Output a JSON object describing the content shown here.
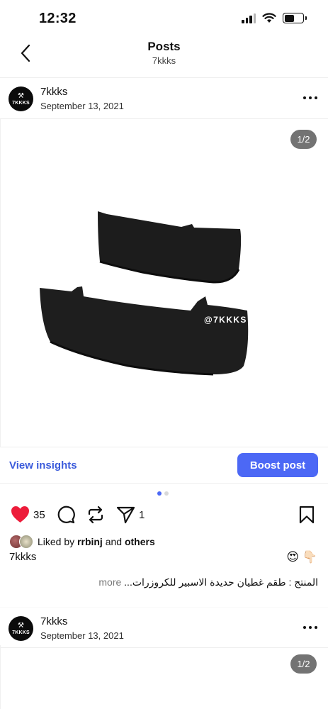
{
  "status_bar": {
    "time": "12:32",
    "icons": [
      "signal-icon",
      "wifi-icon",
      "battery-icon"
    ]
  },
  "nav": {
    "title": "Posts",
    "subtitle": "7kkks",
    "back_icon": "chevron-left-icon"
  },
  "post": {
    "avatar_text": "7KKKS",
    "username": "7kkks",
    "date": "September 13, 2021",
    "media_counter": "1/2",
    "watermark": "@7KKKS",
    "view_insights": "View insights",
    "boost_label": "Boost post",
    "carousel_position": 0,
    "carousel_count": 2,
    "like_count": "35",
    "share_count": "1",
    "liked_by_prefix": "Liked by",
    "liked_by_user": "rrbinj",
    "liked_by_and": "and",
    "liked_by_others": "others",
    "caption_user": "7kkks",
    "emojis": "😍 👇🏻",
    "caption_text": "المنتج : طقم غطيان حديدة الاسبير للكروزرات...",
    "caption_more": "more",
    "accent_color": "#4c68f5",
    "like_color": "#ed1c3a"
  },
  "post2": {
    "avatar_text": "7KKKS",
    "username": "7kkks",
    "date": "September 13, 2021",
    "media_counter": "1/2"
  }
}
